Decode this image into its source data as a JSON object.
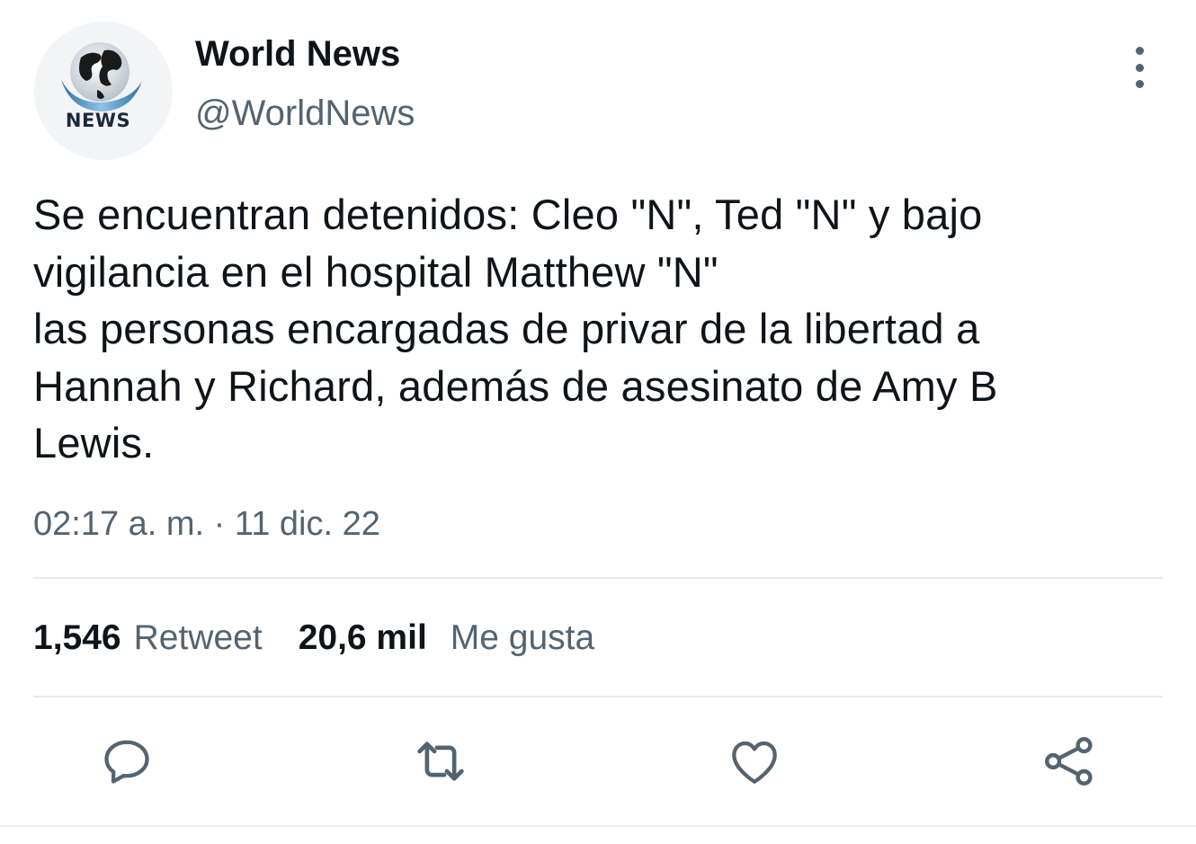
{
  "author": {
    "display_name": "World News",
    "handle": "@WorldNews",
    "avatar_label": "NEWS",
    "avatar_icon": "globe-news-logo"
  },
  "more_icon": "more-vertical-icon",
  "tweet": {
    "text": "Se encuentran detenidos: Cleo \"N\", Ted \"N\" y bajo\nvigilancia en el hospital Matthew \"N\"\nlas personas encargadas de privar de la libertad a\nHannah y Richard, además de asesinato de Amy B\nLewis.",
    "timestamp": "02:17 a. m. · 11 dic. 22"
  },
  "stats": {
    "retweets_count": "1,546",
    "retweets_label": "Retweet",
    "likes_count": "20,6 mil",
    "likes_label": "Me gusta"
  },
  "actions": [
    "reply-icon",
    "retweet-icon",
    "like-icon",
    "share-icon"
  ],
  "colors": {
    "text_primary": "#0f1419",
    "text_secondary": "#536471",
    "divider": "#e7e9ea",
    "icon": "#536471"
  }
}
